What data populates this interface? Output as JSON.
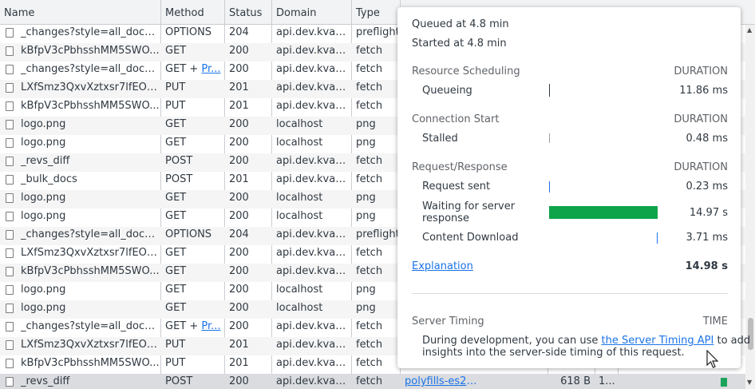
{
  "columns": [
    "Name",
    "Method",
    "Status",
    "Domain",
    "Type"
  ],
  "rows": [
    {
      "name": "_changes?style=all_docs&...",
      "method": "OPTIONS",
      "status": "204",
      "domain": "api.dev.kvad...",
      "type": "preflight"
    },
    {
      "name": "kBfpV3cPbhsshMM5SWO...",
      "method": "GET",
      "status": "200",
      "domain": "api.dev.kvad...",
      "type": "fetch"
    },
    {
      "name": "_changes?style=all_docs&...",
      "method": "GET + ",
      "method_link": "Pr...",
      "status": "200",
      "domain": "api.dev.kvad...",
      "type": "fetch"
    },
    {
      "name": "LXfSmz3QxvXztxsr7lfEOQ...",
      "method": "PUT",
      "status": "201",
      "domain": "api.dev.kvad...",
      "type": "fetch"
    },
    {
      "name": "kBfpV3cPbhsshMM5SWO...",
      "method": "PUT",
      "status": "201",
      "domain": "api.dev.kvad...",
      "type": "fetch"
    },
    {
      "name": "logo.png",
      "method": "GET",
      "status": "200",
      "domain": "localhost",
      "type": "png"
    },
    {
      "name": "logo.png",
      "method": "GET",
      "status": "200",
      "domain": "localhost",
      "type": "png"
    },
    {
      "name": "_revs_diff",
      "method": "POST",
      "status": "200",
      "domain": "api.dev.kvad...",
      "type": "fetch"
    },
    {
      "name": "_bulk_docs",
      "method": "POST",
      "status": "201",
      "domain": "api.dev.kvad...",
      "type": "fetch"
    },
    {
      "name": "logo.png",
      "method": "GET",
      "status": "200",
      "domain": "localhost",
      "type": "png"
    },
    {
      "name": "logo.png",
      "method": "GET",
      "status": "200",
      "domain": "localhost",
      "type": "png"
    },
    {
      "name": "_changes?style=all_docs&...",
      "method": "OPTIONS",
      "status": "204",
      "domain": "api.dev.kvad...",
      "type": "preflight"
    },
    {
      "name": "LXfSmz3QxvXztxsr7lfEOQ...",
      "method": "GET",
      "status": "200",
      "domain": "api.dev.kvad...",
      "type": "fetch"
    },
    {
      "name": "kBfpV3cPbhsshMM5SWO...",
      "method": "GET",
      "status": "200",
      "domain": "api.dev.kvad...",
      "type": "fetch"
    },
    {
      "name": "logo.png",
      "method": "GET",
      "status": "200",
      "domain": "localhost",
      "type": "png"
    },
    {
      "name": "logo.png",
      "method": "GET",
      "status": "200",
      "domain": "localhost",
      "type": "png"
    },
    {
      "name": "_changes?style=all_docs&...",
      "method": "GET + ",
      "method_link": "Pr...",
      "status": "200",
      "domain": "api.dev.kvad...",
      "type": "fetch"
    },
    {
      "name": "LXfSmz3QxvXztxsr7lfEOQ...",
      "method": "PUT",
      "status": "201",
      "domain": "api.dev.kvad...",
      "type": "fetch"
    },
    {
      "name": "kBfpV3cPbhsshMM5SWO...",
      "method": "PUT",
      "status": "201",
      "domain": "api.dev.kvad...",
      "type": "fetch"
    },
    {
      "name": "_revs_diff",
      "method": "POST",
      "status": "200",
      "domain": "api.dev.kvad...",
      "type": "fetch",
      "initiator": "polyfills-es20...",
      "size": "618 B",
      "time": "1..."
    }
  ],
  "timing": {
    "queued": "Queued at 4.8 min",
    "started": "Started at 4.8 min",
    "resource_scheduling": "Resource Scheduling",
    "connection_start": "Connection Start",
    "request_response": "Request/Response",
    "duration_label": "DURATION",
    "queueing": {
      "label": "Queueing",
      "value": "11.86 ms"
    },
    "stalled": {
      "label": "Stalled",
      "value": "0.48 ms"
    },
    "request_sent": {
      "label": "Request sent",
      "value": "0.23 ms"
    },
    "waiting": {
      "label_line1": "Waiting for server",
      "label_line2": "response",
      "value": "14.97 s"
    },
    "content_download": {
      "label": "Content Download",
      "value": "3.71 ms"
    },
    "explanation": "Explanation",
    "total": "14.98 s",
    "server_timing": "Server Timing",
    "time_label": "TIME",
    "server_note_pre": "During development, you can use ",
    "server_note_link": "the Server Timing API",
    "server_note_post1": " to add",
    "server_note_line2": "insights into the server-side timing of this request."
  },
  "colors": {
    "accent": "#1a73e8",
    "waiting_bar": "#0ea44a",
    "waterfall_bar": "#1aa35a"
  }
}
